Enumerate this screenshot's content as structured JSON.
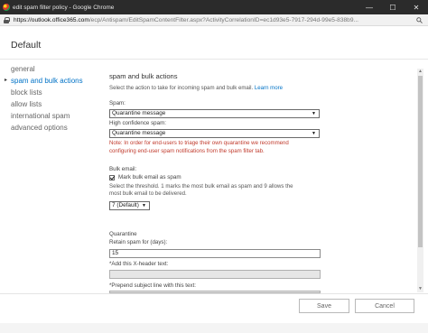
{
  "window": {
    "title": "edit spam filter policy - Google Chrome",
    "minimize_glyph": "—",
    "maximize_glyph": "☐",
    "close_glyph": "✕"
  },
  "address_bar": {
    "host": "https://outlook.office365.com",
    "path": "/ecp/Antispam/EditSpamContentFilter.aspx?ActivityCorrelationID=ec1d93e5-7917-294d-99e5-838b9..."
  },
  "page": {
    "title": "Default"
  },
  "nav": {
    "items": [
      {
        "label": "general",
        "active": false
      },
      {
        "label": "spam and bulk actions",
        "active": true
      },
      {
        "label": "block lists",
        "active": false
      },
      {
        "label": "allow lists",
        "active": false
      },
      {
        "label": "international spam",
        "active": false
      },
      {
        "label": "advanced options",
        "active": false
      }
    ],
    "active_caret": "▸"
  },
  "content": {
    "heading": "spam and bulk actions",
    "description": "Select the action to take for incoming spam and bulk email.",
    "learn_more": "Learn more",
    "spam_label": "Spam:",
    "spam_value": "Quarantine message",
    "high_conf_label": "High confidence spam:",
    "high_conf_value": "Quarantine message",
    "note_line1": "Note: In order for end-users to triage their own quarantine we recommend",
    "note_line2": "configuring end-user spam notifications from the spam filter tab.",
    "bulk_label": "Bulk email:",
    "bulk_checkbox_label": "Mark bulk email as spam",
    "threshold_line1": "Select the threshold. 1 marks the most bulk email as spam and 9 allows the",
    "threshold_line2": "most bulk email to be delivered.",
    "threshold_value": "7 (Default)",
    "quarantine_heading": "Quarantine",
    "retain_label": "Retain spam for (days):",
    "retain_value": "15",
    "xheader_label": "*Add this X-header text:",
    "prepend_label": "*Prepend subject line with this text:"
  },
  "footer": {
    "save_label": "Save",
    "cancel_label": "Cancel"
  },
  "colors": {
    "accent": "#0072c6",
    "warning": "#c0392b",
    "titlebar": "#2b2b2b"
  }
}
